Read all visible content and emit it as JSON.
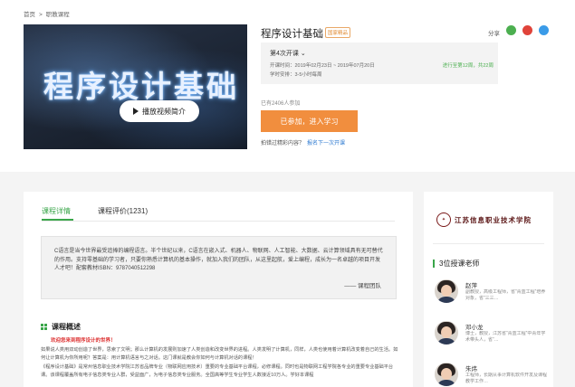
{
  "breadcrumb": {
    "home": "首页",
    "sep": ">",
    "current": "职教课程"
  },
  "cover": {
    "big_text": "程序设计基础",
    "play_label": "播放视频简介"
  },
  "course": {
    "title": "程序设计基础",
    "badge": "国家精品",
    "share_label": "分享",
    "term": "第4次开课",
    "term_arrow": "⌄",
    "open_time": "开课时间：2019年02月23日 ~ 2019年07月20日",
    "hours": "学时安排：3-5小时每周",
    "progress": "进行至第12周，共22周",
    "joined": "已有2406人参加",
    "join_button": "已参加，进入学习",
    "missed_text": "拍错过精彩内容？",
    "missed_link": "报名下一次开课"
  },
  "share_icons": [
    {
      "name": "wechat-icon",
      "glyph": "●",
      "color": "#4caf50"
    },
    {
      "name": "weibo-icon",
      "glyph": "●",
      "color": "#e0433a"
    },
    {
      "name": "qq-icon",
      "glyph": "●",
      "color": "#3a9be8"
    }
  ],
  "tabs": {
    "detail": "课程详情",
    "review": "课程评价(1231)"
  },
  "quote": {
    "text": "C语言是当今世界最受追捧的编程语言。半个世纪以来，C语言在嵌入式、机器人、物联网、人工智能、大数据、云计算领域具有无可替代的作用。支持零基础的学习者，只要你熟悉计算机的基本操作，就加入我们的团队，从这里起航，爱上编程，成长为一名卓越的项目开发人才吧！配套教材ISBN：9787040512298",
    "signature": "—— 课程团队"
  },
  "overview": {
    "heading": "课程概述",
    "welcome": "欢迎您来到程序设计的世界！",
    "p1": "如果说人类用双动创造了世界，思索了文明；那么计算机的发展则加速了人类创造和改变世界的进程。人类发明了计算机，同样，人类也使用着计算机改变着自己的生活。如何让计算机为你所用呢？答案是：用计算机语言与之对话。这门课就是教会你如何与计算机对话的课程！",
    "p2": "《程序设计基础》是常州信息职业技术学院江苏省品牌专业（物联网应用技术）重要的专业基础平台课程，必修课程。同时也是物联网工程学院各专业的重要专业基础平台课。该课程覆盖所有电子信息类专业人群，受益面广，为电子信息类专业服务。全国高等学生专业学生人数接近10万人。学好本课程"
  },
  "sidebar": {
    "logo_text": "江苏信息职业技术学院",
    "teachers_heading": "3位授课老师",
    "teachers": [
      {
        "name": "赵萍",
        "desc": "副教授，高级工程师，省“青蓝工程”培养对象，省“三三…"
      },
      {
        "name": "邓小龙",
        "desc": "博士，教授，江苏省“青蓝工程”中青年学术带头人，省“…"
      },
      {
        "name": "朱炜",
        "desc": "工程师，长期从事计算机软件开发及课程教学工作…"
      }
    ]
  }
}
